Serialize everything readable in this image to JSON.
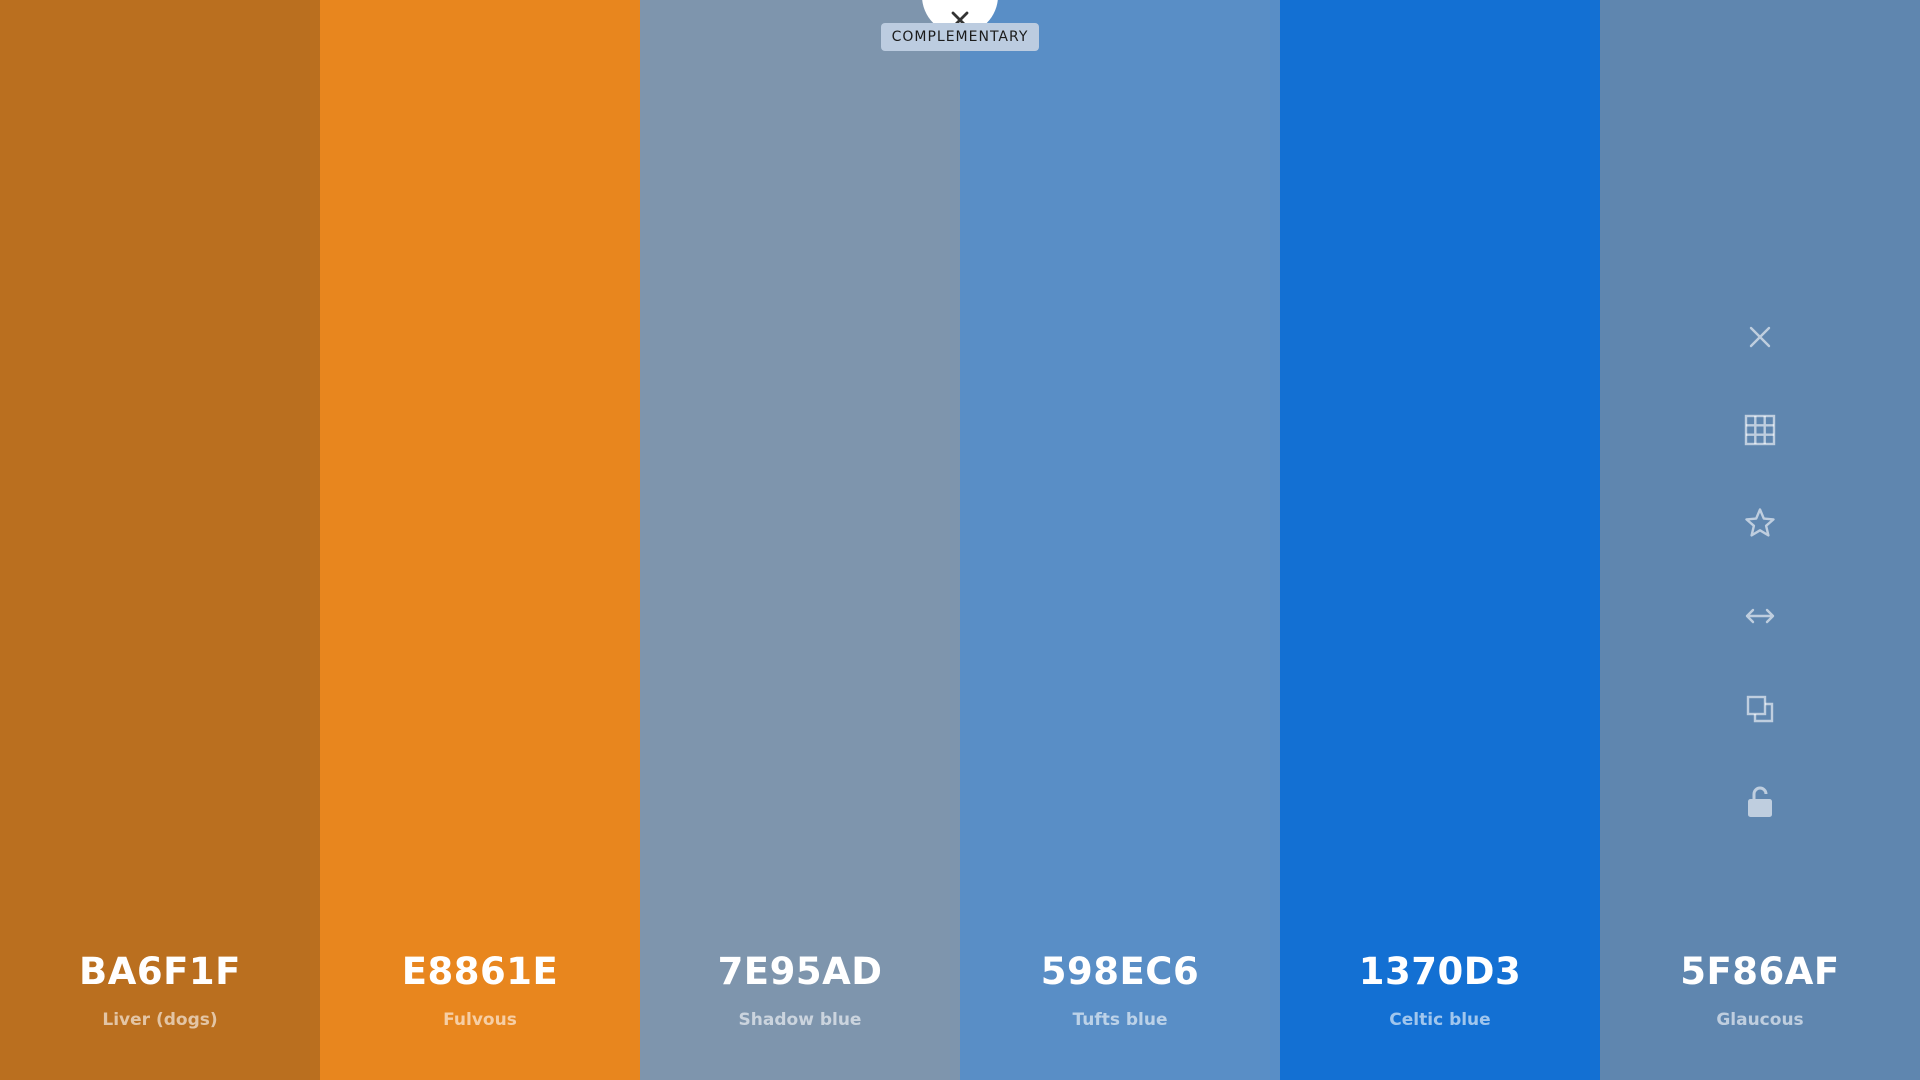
{
  "tooltip": {
    "label": "COMPLEMENTARY"
  },
  "colors": [
    {
      "hex": "BA6F1F",
      "name": "Liver (dogs)",
      "color": "#BA6F1F"
    },
    {
      "hex": "E8861E",
      "name": "Fulvous",
      "color": "#E8861E"
    },
    {
      "hex": "7E95AD",
      "name": "Shadow blue",
      "color": "#7E95AD"
    },
    {
      "hex": "598EC6",
      "name": "Tufts blue",
      "color": "#598EC6"
    },
    {
      "hex": "1370D3",
      "name": "Celtic blue",
      "color": "#1370D3"
    },
    {
      "hex": "5F86AF",
      "name": "Glaucous",
      "color": "#5F86AF"
    }
  ],
  "hovered_swatch_tools": [
    "close-icon",
    "grid-icon",
    "star-icon",
    "arrows-horizontal-icon",
    "copy-icon",
    "unlock-icon"
  ]
}
